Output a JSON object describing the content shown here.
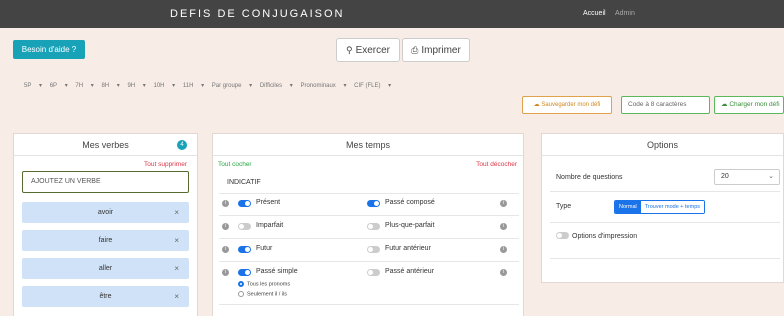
{
  "app": {
    "title": "DEFIS DE CONJUGAISON",
    "nav_accueil": "Accueil",
    "nav_admin": "Admin"
  },
  "toolbar": {
    "help_label": "Besoin d'aide ?",
    "exercise_label": "Exercer",
    "print_label": "Imprimer"
  },
  "filters": [
    "5P",
    "6P",
    "7H",
    "8H",
    "9H",
    "10H",
    "11H",
    "Par groupe",
    "Difficiles",
    "Pronominaux",
    "CIF (FLE)"
  ],
  "defi": {
    "save_label": "Sauvegarder mon défi",
    "code_placeholder": "Code à 8 caractères",
    "load_label": "Charger mon défi"
  },
  "verbes": {
    "title": "Mes verbes",
    "count": "4",
    "delete_all": "Tout supprimer",
    "add_placeholder": "AJOUTEZ UN VERBE",
    "items": [
      "avoir",
      "faire",
      "aller",
      "être"
    ],
    "remove_symbol": "×"
  },
  "temps": {
    "title": "Mes temps",
    "check_all": "Tout cocher",
    "uncheck_all": "Tout décocher",
    "mode": "INDICATIF",
    "info_symbol": "i",
    "left": [
      {
        "label": "Présent",
        "on": true
      },
      {
        "label": "Imparfait",
        "on": false
      },
      {
        "label": "Futur",
        "on": true
      },
      {
        "label": "Passé simple",
        "on": true
      }
    ],
    "right": [
      {
        "label": "Passé composé",
        "on": true
      },
      {
        "label": "Plus-que-parfait",
        "on": false
      },
      {
        "label": "Futur antérieur",
        "on": false
      },
      {
        "label": "Passé antérieur",
        "on": false
      }
    ],
    "pronoun_options": [
      "Tous les pronoms",
      "Seulement il / ils"
    ]
  },
  "options": {
    "title": "Options",
    "questions_label": "Nombre de questions",
    "questions_value": "20",
    "type_label": "Type",
    "type_modes": [
      "Normal",
      "Trouver mode + temps"
    ],
    "print_options_label": "Options d'impression"
  },
  "colors": {
    "accent": "#17a2b8",
    "primary": "#1a73e8",
    "danger": "#dc3545",
    "success": "#28a745",
    "warning": "#e0a24a"
  }
}
